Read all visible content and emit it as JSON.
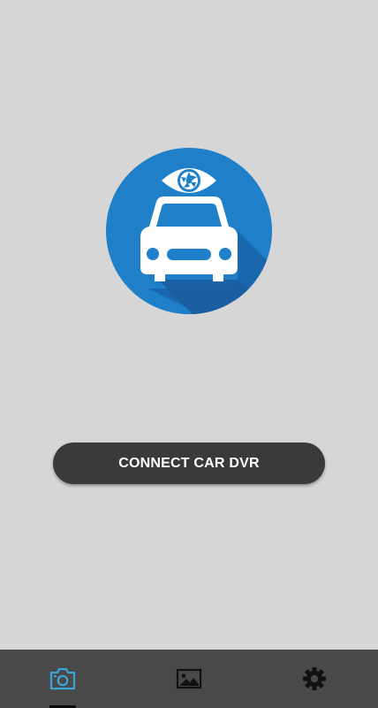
{
  "app": {
    "logo": {
      "icon": "car-dvr-eye-logo",
      "circle_color": "#1f7fc8",
      "shadow_color": "#1a5f9f"
    }
  },
  "main": {
    "connect_button_label": "CONNECT CAR DVR"
  },
  "bottom_nav": {
    "items": [
      {
        "icon": "camera-icon",
        "selected": true,
        "color": "#3aa6d8"
      },
      {
        "icon": "gallery-icon",
        "selected": false,
        "color": "#111111"
      },
      {
        "icon": "settings-icon",
        "selected": false,
        "color": "#111111"
      }
    ]
  }
}
